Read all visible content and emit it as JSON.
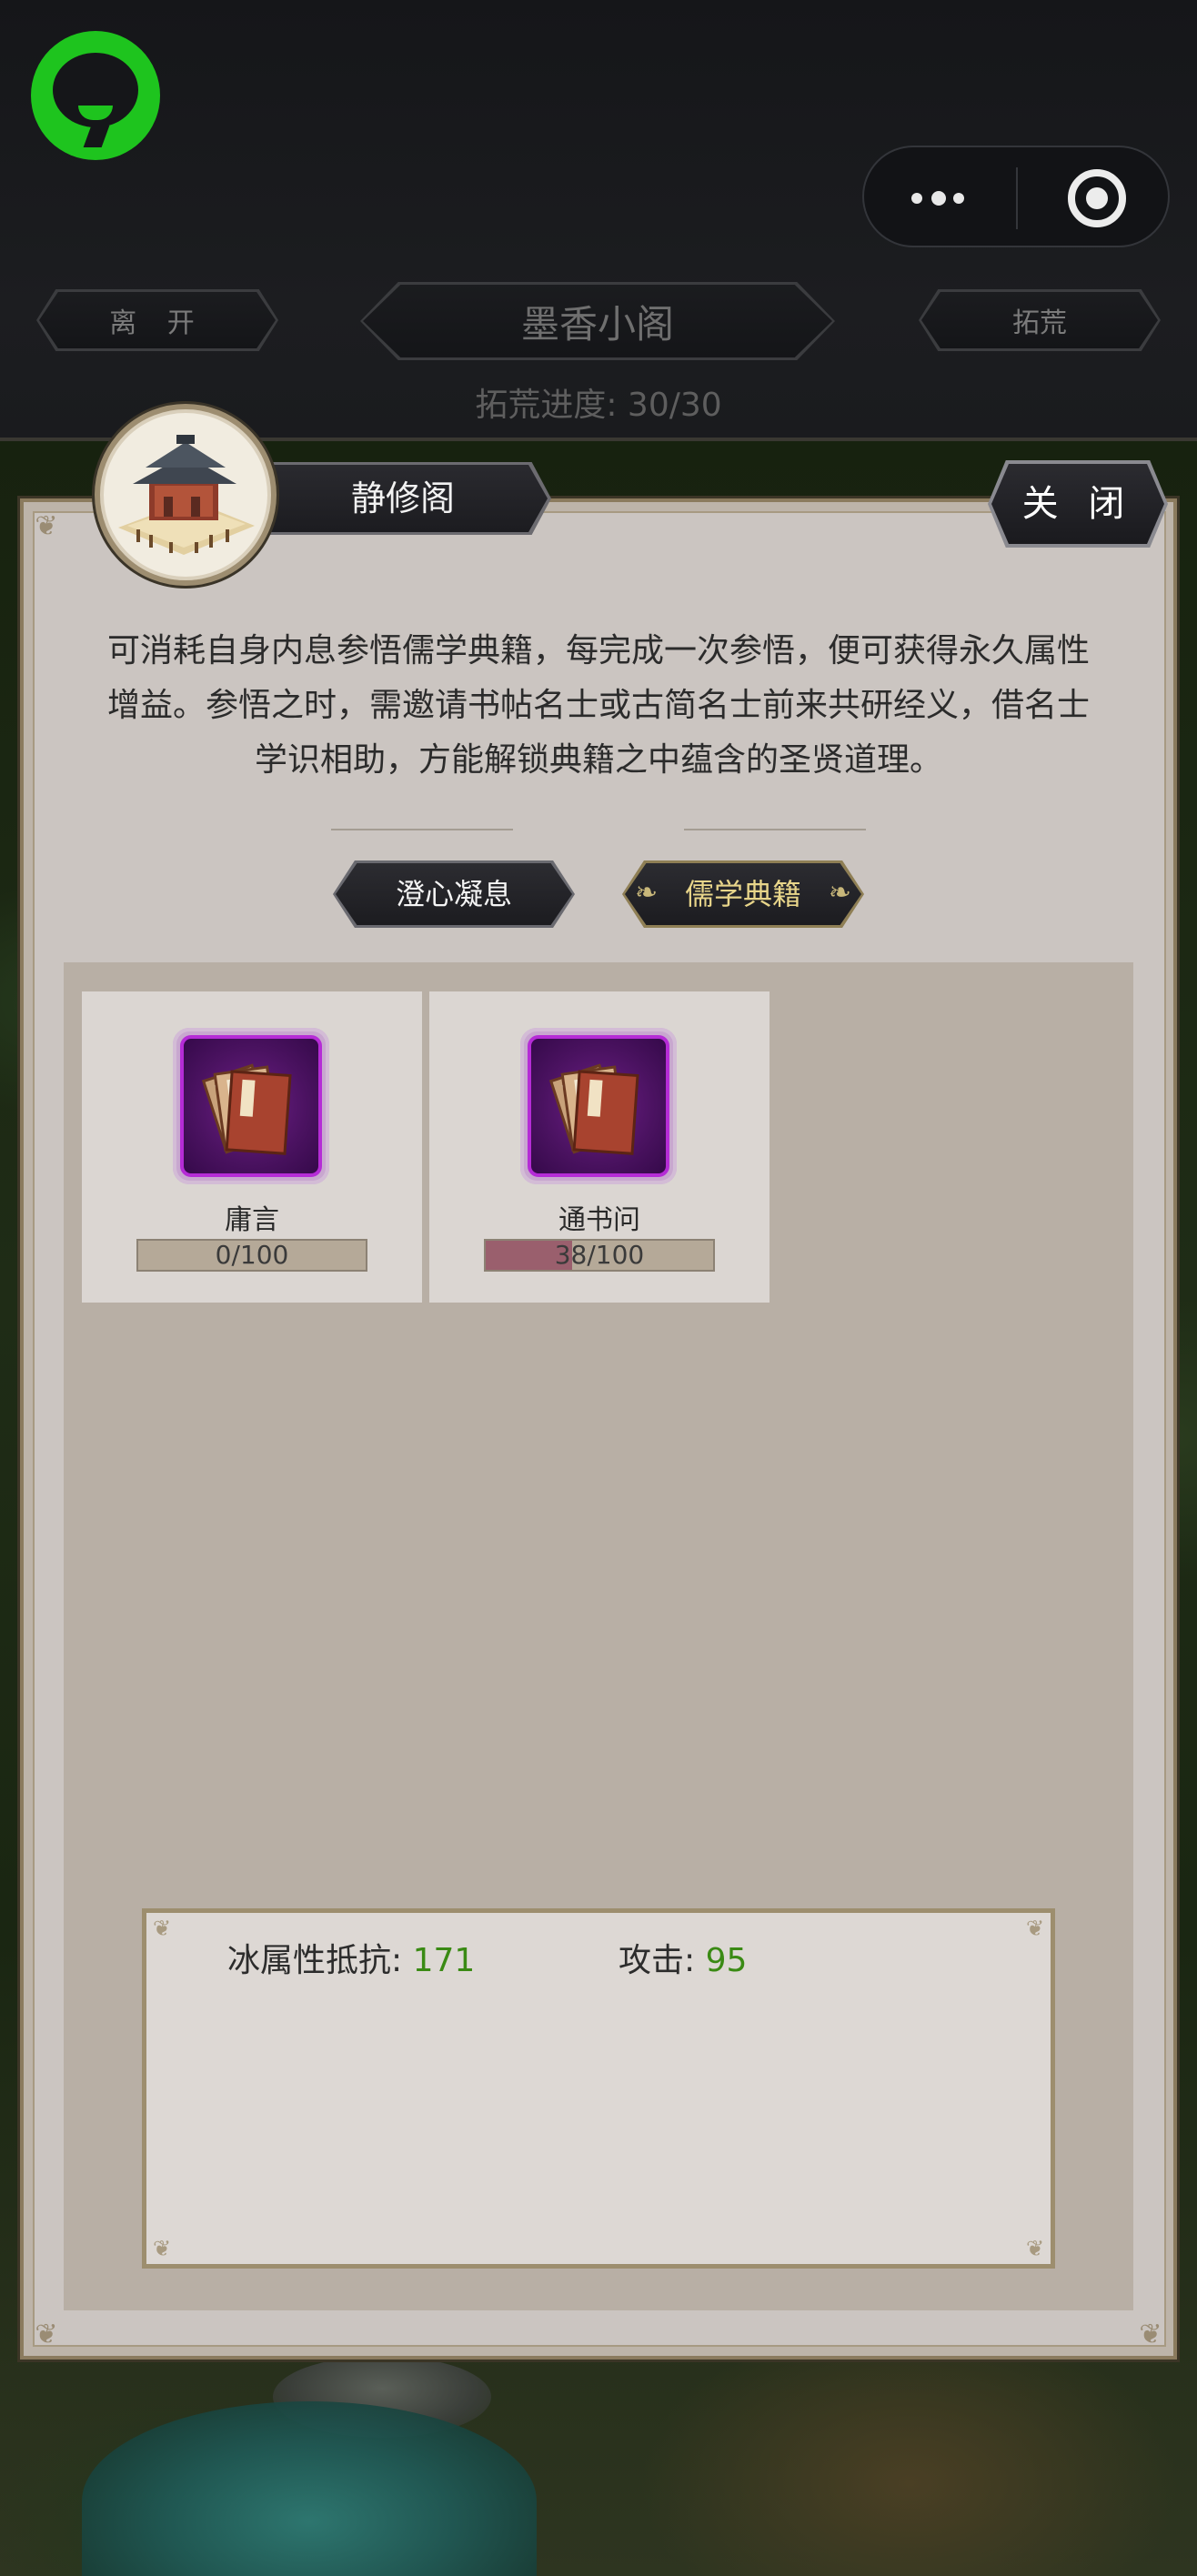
{
  "topbar": {
    "leave_label": "离 开",
    "location_title": "墨香小阁",
    "explore_label": "拓荒",
    "progress_label": "拓荒进度:",
    "progress_value": "30/30"
  },
  "panel": {
    "title": "静修阁",
    "close_label": "关 闭",
    "description": "可消耗自身内息参悟儒学典籍，每完成一次参悟，便可获得永久属性增益。参悟之时，需邀请书帖名士或古简名士前来共研经义，借名士学识相助，方能解锁典籍之中蕴含的圣贤道理。",
    "tabs": [
      {
        "label": "澄心凝息",
        "active": false
      },
      {
        "label": "儒学典籍",
        "active": true
      }
    ],
    "books": [
      {
        "name": "庸言",
        "progress_text": "0/100",
        "progress": 0,
        "icon": "book-stack-icon"
      },
      {
        "name": "通书问",
        "progress_text": "38/100",
        "progress": 0.38,
        "icon": "book-stack-icon"
      }
    ],
    "stats": [
      {
        "label": "冰属性抵抗:",
        "value": "171"
      },
      {
        "label": "攻击:",
        "value": "95"
      }
    ]
  },
  "colors": {
    "wechat_green": "#1ec41e",
    "stat_value_green": "#3a8a14",
    "active_tab_text": "#e8d58a",
    "progress_fill": "#9a5f6d"
  }
}
